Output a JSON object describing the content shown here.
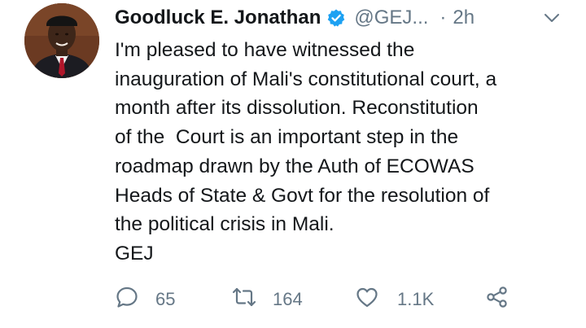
{
  "tweet": {
    "author_name": "Goodluck E. Jonathan",
    "handle": "@GEJ...",
    "separator": "·",
    "time": "2h",
    "text_lines": [
      "I'm pleased to have witnessed the",
      "inauguration of Mali's constitutional court, a",
      "month after its dissolution. Reconstitution",
      "of the  Court is an important step in the",
      "roadmap drawn by the Auth of ECOWAS",
      "Heads of State & Govt for the resolution of",
      "the political crisis in Mali.",
      "GEJ"
    ]
  },
  "actions": {
    "reply_count": "65",
    "retweet_count": "164",
    "like_count": "1.1K"
  },
  "colors": {
    "text": "#14171a",
    "secondary": "#657786",
    "verified": "#1da1f2",
    "background": "#ffffff"
  },
  "icons": [
    "avatar",
    "verified-badge-icon",
    "chevron-down-icon",
    "reply-icon",
    "retweet-icon",
    "like-icon",
    "share-icon"
  ]
}
